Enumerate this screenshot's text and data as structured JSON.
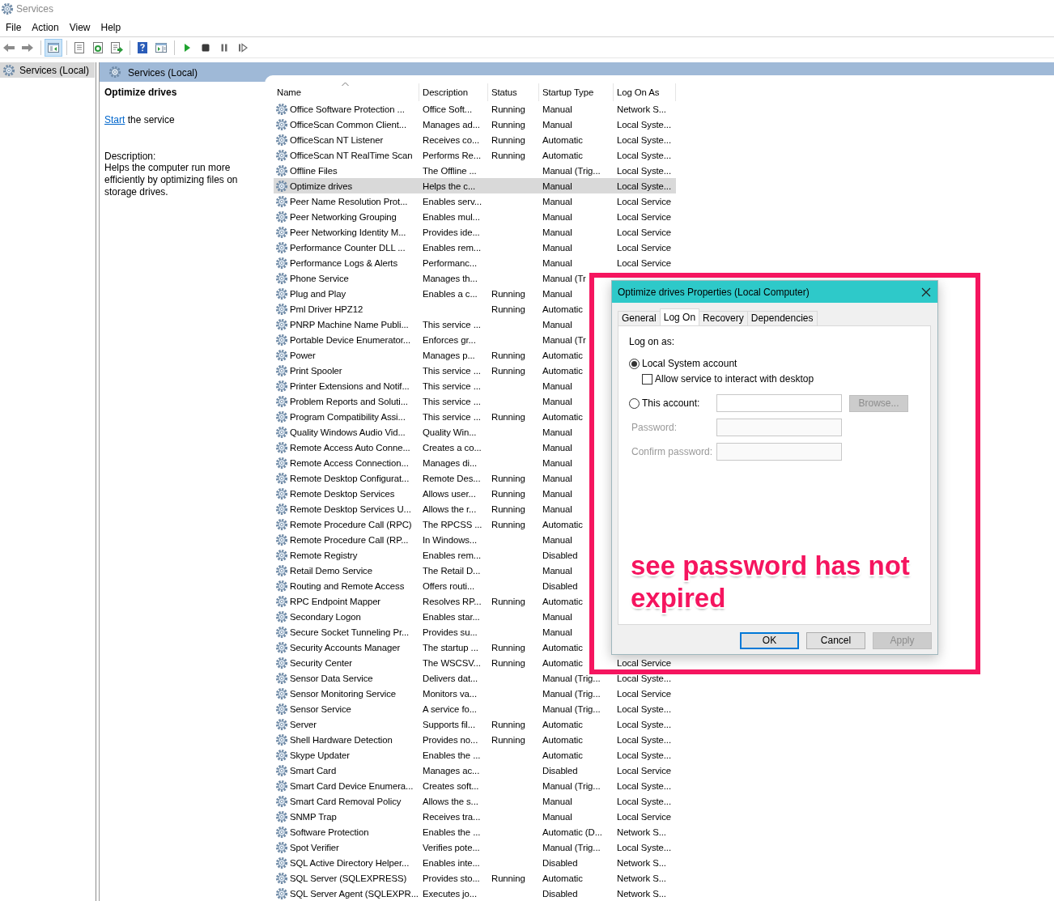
{
  "window": {
    "title": "Services"
  },
  "menu": [
    "File",
    "Action",
    "View",
    "Help"
  ],
  "toolbar": [
    {
      "kind": "back",
      "pressed": false
    },
    {
      "kind": "forward",
      "pressed": false
    },
    {
      "kind": "separator"
    },
    {
      "kind": "console-tree",
      "pressed": true
    },
    {
      "kind": "separator"
    },
    {
      "kind": "properties",
      "pressed": false
    },
    {
      "kind": "refresh",
      "pressed": false
    },
    {
      "kind": "export",
      "pressed": false
    },
    {
      "kind": "separator"
    },
    {
      "kind": "help",
      "pressed": false
    },
    {
      "kind": "action-pane",
      "pressed": false
    },
    {
      "kind": "separator"
    },
    {
      "kind": "start",
      "pressed": false
    },
    {
      "kind": "stop",
      "pressed": false
    },
    {
      "kind": "pause",
      "pressed": false
    },
    {
      "kind": "resume",
      "pressed": false
    }
  ],
  "tree": {
    "items": [
      {
        "label": "Services (Local)",
        "selected": true
      }
    ]
  },
  "header": {
    "title": "Services (Local)"
  },
  "details": {
    "service_name": "Optimize drives",
    "action_link": "Start",
    "action_text": "the service",
    "description_label": "Description:",
    "description": "Helps the computer run more efficiently by optimizing files on storage drives."
  },
  "table": {
    "columns": [
      {
        "label": "Name",
        "sorted": true
      },
      {
        "label": "Description",
        "sorted": false
      },
      {
        "label": "Status",
        "sorted": false
      },
      {
        "label": "Startup Type",
        "sorted": false
      },
      {
        "label": "Log On As",
        "sorted": false
      }
    ],
    "rows": [
      {
        "name": "Office Software Protection ...",
        "description": "Office Soft...",
        "status": "Running",
        "startup_type": "Manual",
        "log_on_as": "Network S...",
        "selected": false
      },
      {
        "name": "OfficeScan Common Client...",
        "description": "Manages ad...",
        "status": "Running",
        "startup_type": "Manual",
        "log_on_as": "Local Syste...",
        "selected": false
      },
      {
        "name": "OfficeScan NT Listener",
        "description": "Receives co...",
        "status": "Running",
        "startup_type": "Automatic",
        "log_on_as": "Local Syste...",
        "selected": false
      },
      {
        "name": "OfficeScan NT RealTime Scan",
        "description": "Performs Re...",
        "status": "Running",
        "startup_type": "Automatic",
        "log_on_as": "Local Syste...",
        "selected": false
      },
      {
        "name": "Offline Files",
        "description": "The Offline ...",
        "startup_type": "Manual (Trig...",
        "log_on_as": "Local Syste...",
        "selected": false
      },
      {
        "name": "Optimize drives",
        "description": "Helps the c...",
        "startup_type": "Manual",
        "log_on_as": "Local Syste...",
        "selected": true
      },
      {
        "name": "Peer Name Resolution Prot...",
        "description": "Enables serv...",
        "startup_type": "Manual",
        "log_on_as": "Local Service",
        "selected": false
      },
      {
        "name": "Peer Networking Grouping",
        "description": "Enables mul...",
        "startup_type": "Manual",
        "log_on_as": "Local Service",
        "selected": false
      },
      {
        "name": "Peer Networking Identity M...",
        "description": "Provides ide...",
        "startup_type": "Manual",
        "log_on_as": "Local Service",
        "selected": false
      },
      {
        "name": "Performance Counter DLL ...",
        "description": "Enables rem...",
        "startup_type": "Manual",
        "log_on_as": "Local Service",
        "selected": false
      },
      {
        "name": "Performance Logs & Alerts",
        "description": "Performanc...",
        "startup_type": "Manual",
        "log_on_as": "Local Service",
        "selected": false
      },
      {
        "name": "Phone Service",
        "description": "Manages th...",
        "startup_type": "Manual (Tr",
        "selected": false
      },
      {
        "name": "Plug and Play",
        "description": "Enables a c...",
        "status": "Running",
        "startup_type": "Manual",
        "selected": false
      },
      {
        "name": "Pml Driver HPZ12",
        "status": "Running",
        "startup_type": "Automatic",
        "selected": false
      },
      {
        "name": "PNRP Machine Name Publi...",
        "description": "This service ...",
        "startup_type": "Manual",
        "selected": false
      },
      {
        "name": "Portable Device Enumerator...",
        "description": "Enforces gr...",
        "startup_type": "Manual (Tr",
        "selected": false
      },
      {
        "name": "Power",
        "description": "Manages p...",
        "status": "Running",
        "startup_type": "Automatic",
        "selected": false
      },
      {
        "name": "Print Spooler",
        "description": "This service ...",
        "status": "Running",
        "startup_type": "Automatic",
        "selected": false
      },
      {
        "name": "Printer Extensions and Notif...",
        "description": "This service ...",
        "startup_type": "Manual",
        "selected": false
      },
      {
        "name": "Problem Reports and Soluti...",
        "description": "This service ...",
        "startup_type": "Manual",
        "selected": false
      },
      {
        "name": "Program Compatibility Assi...",
        "description": "This service ...",
        "status": "Running",
        "startup_type": "Automatic",
        "selected": false
      },
      {
        "name": "Quality Windows Audio Vid...",
        "description": "Quality Win...",
        "startup_type": "Manual",
        "selected": false
      },
      {
        "name": "Remote Access Auto Conne...",
        "description": "Creates a co...",
        "startup_type": "Manual",
        "selected": false
      },
      {
        "name": "Remote Access Connection...",
        "description": "Manages di...",
        "startup_type": "Manual",
        "selected": false
      },
      {
        "name": "Remote Desktop Configurat...",
        "description": "Remote Des...",
        "status": "Running",
        "startup_type": "Manual",
        "selected": false
      },
      {
        "name": "Remote Desktop Services",
        "description": "Allows user...",
        "status": "Running",
        "startup_type": "Manual",
        "selected": false
      },
      {
        "name": "Remote Desktop Services U...",
        "description": "Allows the r...",
        "status": "Running",
        "startup_type": "Manual",
        "selected": false
      },
      {
        "name": "Remote Procedure Call (RPC)",
        "description": "The RPCSS ...",
        "status": "Running",
        "startup_type": "Automatic",
        "selected": false
      },
      {
        "name": "Remote Procedure Call (RP...",
        "description": "In Windows...",
        "startup_type": "Manual",
        "selected": false
      },
      {
        "name": "Remote Registry",
        "description": "Enables rem...",
        "startup_type": "Disabled",
        "selected": false
      },
      {
        "name": "Retail Demo Service",
        "description": "The Retail D...",
        "startup_type": "Manual",
        "selected": false
      },
      {
        "name": "Routing and Remote Access",
        "description": "Offers routi...",
        "startup_type": "Disabled",
        "selected": false
      },
      {
        "name": "RPC Endpoint Mapper",
        "description": "Resolves RP...",
        "status": "Running",
        "startup_type": "Automatic",
        "selected": false
      },
      {
        "name": "Secondary Logon",
        "description": "Enables star...",
        "startup_type": "Manual",
        "selected": false
      },
      {
        "name": "Secure Socket Tunneling Pr...",
        "description": "Provides su...",
        "startup_type": "Manual",
        "selected": false
      },
      {
        "name": "Security Accounts Manager",
        "description": "The startup ...",
        "status": "Running",
        "startup_type": "Automatic",
        "selected": false
      },
      {
        "name": "Security Center",
        "description": "The WSCSV...",
        "status": "Running",
        "startup_type": "Automatic",
        "log_on_as": "Local Service",
        "selected": false
      },
      {
        "name": "Sensor Data Service",
        "description": "Delivers dat...",
        "startup_type": "Manual (Trig...",
        "log_on_as": "Local Syste...",
        "selected": false
      },
      {
        "name": "Sensor Monitoring Service",
        "description": "Monitors va...",
        "startup_type": "Manual (Trig...",
        "log_on_as": "Local Service",
        "selected": false
      },
      {
        "name": "Sensor Service",
        "description": "A service fo...",
        "startup_type": "Manual (Trig...",
        "log_on_as": "Local Syste...",
        "selected": false
      },
      {
        "name": "Server",
        "description": "Supports fil...",
        "status": "Running",
        "startup_type": "Automatic",
        "log_on_as": "Local Syste...",
        "selected": false
      },
      {
        "name": "Shell Hardware Detection",
        "description": "Provides no...",
        "status": "Running",
        "startup_type": "Automatic",
        "log_on_as": "Local Syste...",
        "selected": false
      },
      {
        "name": "Skype Updater",
        "description": "Enables the ...",
        "startup_type": "Automatic",
        "log_on_as": "Local Syste...",
        "selected": false
      },
      {
        "name": "Smart Card",
        "description": "Manages ac...",
        "startup_type": "Disabled",
        "log_on_as": "Local Service",
        "selected": false
      },
      {
        "name": "Smart Card Device Enumera...",
        "description": "Creates soft...",
        "startup_type": "Manual (Trig...",
        "log_on_as": "Local Syste...",
        "selected": false
      },
      {
        "name": "Smart Card Removal Policy",
        "description": "Allows the s...",
        "startup_type": "Manual",
        "log_on_as": "Local Syste...",
        "selected": false
      },
      {
        "name": "SNMP Trap",
        "description": "Receives tra...",
        "startup_type": "Manual",
        "log_on_as": "Local Service",
        "selected": false
      },
      {
        "name": "Software Protection",
        "description": "Enables the ...",
        "startup_type": "Automatic (D...",
        "log_on_as": "Network S...",
        "selected": false
      },
      {
        "name": "Spot Verifier",
        "description": "Verifies pote...",
        "startup_type": "Manual (Trig...",
        "log_on_as": "Local Syste...",
        "selected": false
      },
      {
        "name": "SQL Active Directory Helper...",
        "description": "Enables inte...",
        "startup_type": "Disabled",
        "log_on_as": "Network S...",
        "selected": false
      },
      {
        "name": "SQL Server (SQLEXPRESS)",
        "description": "Provides sto...",
        "status": "Running",
        "startup_type": "Automatic",
        "log_on_as": "Network S...",
        "selected": false
      },
      {
        "name": "SQL Server Agent (SQLEXPR...",
        "description": "Executes jo...",
        "startup_type": "Disabled",
        "log_on_as": "Network S...",
        "selected": false
      }
    ]
  },
  "dialog": {
    "title": "Optimize drives Properties (Local Computer)",
    "tabs": [
      {
        "label": "General",
        "selected": false
      },
      {
        "label": "Log On",
        "selected": true
      },
      {
        "label": "Recovery",
        "selected": false
      },
      {
        "label": "Dependencies",
        "selected": false
      }
    ],
    "log_on_label": "Log on as:",
    "local_system": {
      "label": "Local System account",
      "selected": true
    },
    "interact": {
      "label": "Allow service to interact with desktop",
      "checked": false
    },
    "this_account": {
      "label": "This account:",
      "selected": false
    },
    "browse": {
      "label": "Browse...",
      "disabled": true
    },
    "password_fields": [
      {
        "label": "Password:",
        "disabled": true
      },
      {
        "label": "Confirm password:",
        "disabled": true
      }
    ],
    "buttons": [
      {
        "label": "OK",
        "default": true,
        "disabled": false
      },
      {
        "label": "Cancel",
        "default": false,
        "disabled": false
      },
      {
        "label": "Apply",
        "default": false,
        "disabled": true
      }
    ]
  },
  "annotation": {
    "text": "see password has not expired"
  }
}
